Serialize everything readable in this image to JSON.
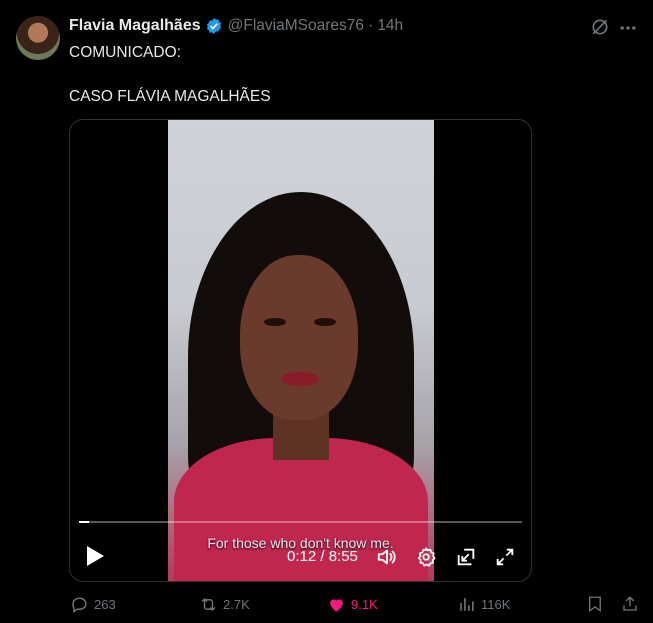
{
  "tweet": {
    "author_name": "Flavia Magalhães",
    "handle": "@FlaviaMSoares76",
    "separator": "·",
    "time": "14h",
    "text_line1": "COMUNICADO:",
    "text_line2": "CASO FLÁVIA MAGALHÃES",
    "verified_icon": "verified-badge-icon"
  },
  "video": {
    "subtitle": "For those who don't know me.",
    "time_display": "0:12 / 8:55",
    "progress": 0.022
  },
  "actions": {
    "replies": "263",
    "reposts": "2.7K",
    "likes": "9.1K",
    "views": "116K"
  },
  "colors": {
    "background": "#000000",
    "muted": "#71767b",
    "verified": "#1d9bf0",
    "like": "#f91880"
  }
}
